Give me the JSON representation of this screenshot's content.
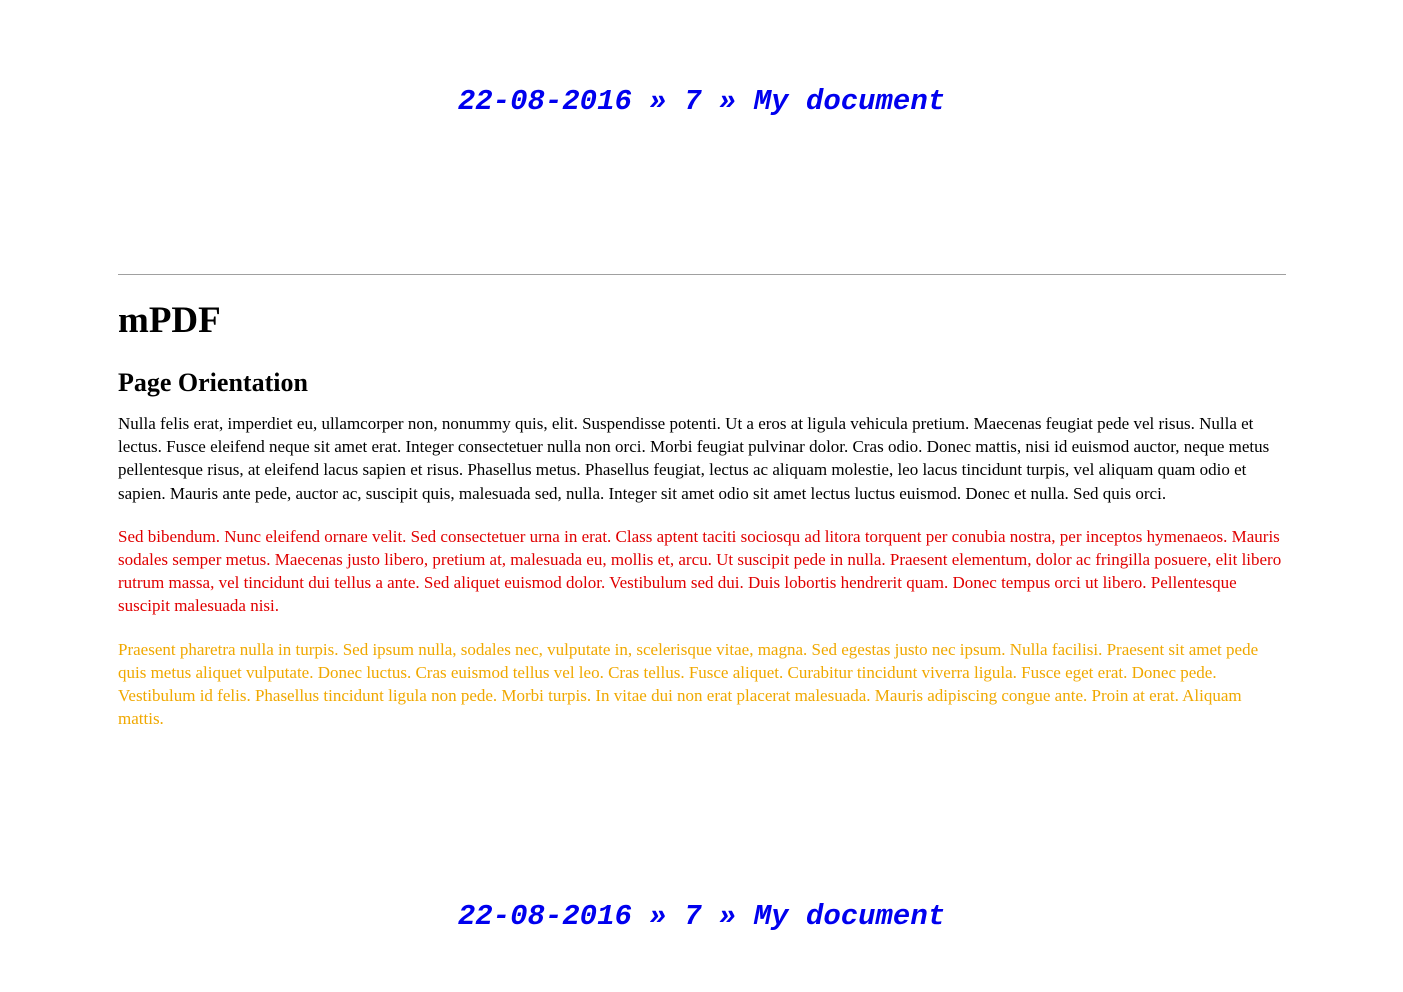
{
  "header": {
    "text": "22-08-2016 » 7 » My document"
  },
  "footer": {
    "text": "22-08-2016 » 7 » My document"
  },
  "document": {
    "title": "mPDF",
    "subtitle": "Page Orientation",
    "paragraphs": [
      {
        "text": "Nulla felis erat, imperdiet eu, ullamcorper non, nonummy quis, elit. Suspendisse potenti. Ut a eros at ligula vehicula pretium. Maecenas feugiat pede vel risus. Nulla et lectus. Fusce eleifend neque sit amet erat. Integer consectetuer nulla non orci. Morbi feugiat pulvinar dolor. Cras odio. Donec mattis, nisi id euismod auctor, neque metus pellentesque risus, at eleifend lacus sapien et risus. Phasellus metus. Phasellus feugiat, lectus ac aliquam molestie, leo lacus tincidunt turpis, vel aliquam quam odio et sapien. Mauris ante pede, auctor ac, suscipit quis, malesuada sed, nulla. Integer sit amet odio sit amet lectus luctus euismod. Donec et nulla. Sed quis orci.",
        "color": "#000000"
      },
      {
        "text": "Sed bibendum. Nunc eleifend ornare velit. Sed consectetuer urna in erat. Class aptent taciti sociosqu ad litora torquent per conubia nostra, per inceptos hymenaeos. Mauris sodales semper metus. Maecenas justo libero, pretium at, malesuada eu, mollis et, arcu. Ut suscipit pede in nulla. Praesent elementum, dolor ac fringilla posuere, elit libero rutrum massa, vel tincidunt dui tellus a ante. Sed aliquet euismod dolor. Vestibulum sed dui. Duis lobortis hendrerit quam. Donec tempus orci ut libero. Pellentesque suscipit malesuada nisi.",
        "color": "#e00000"
      },
      {
        "text": "Praesent pharetra nulla in turpis. Sed ipsum nulla, sodales nec, vulputate in, scelerisque vitae, magna. Sed egestas justo nec ipsum. Nulla facilisi. Praesent sit amet pede quis metus aliquet vulputate. Donec luctus. Cras euismod tellus vel leo. Cras tellus. Fusce aliquet. Curabitur tincidunt viverra ligula. Fusce eget erat. Donec pede. Vestibulum id felis. Phasellus tincidunt ligula non pede. Morbi turpis. In vitae dui non erat placerat malesuada. Mauris adipiscing congue ante. Proin at erat. Aliquam mattis.",
        "color": "#f0a800"
      }
    ]
  },
  "colors": {
    "header_text": "#0000ee",
    "rule": "#a0a0a0",
    "body_text": "#000000"
  }
}
